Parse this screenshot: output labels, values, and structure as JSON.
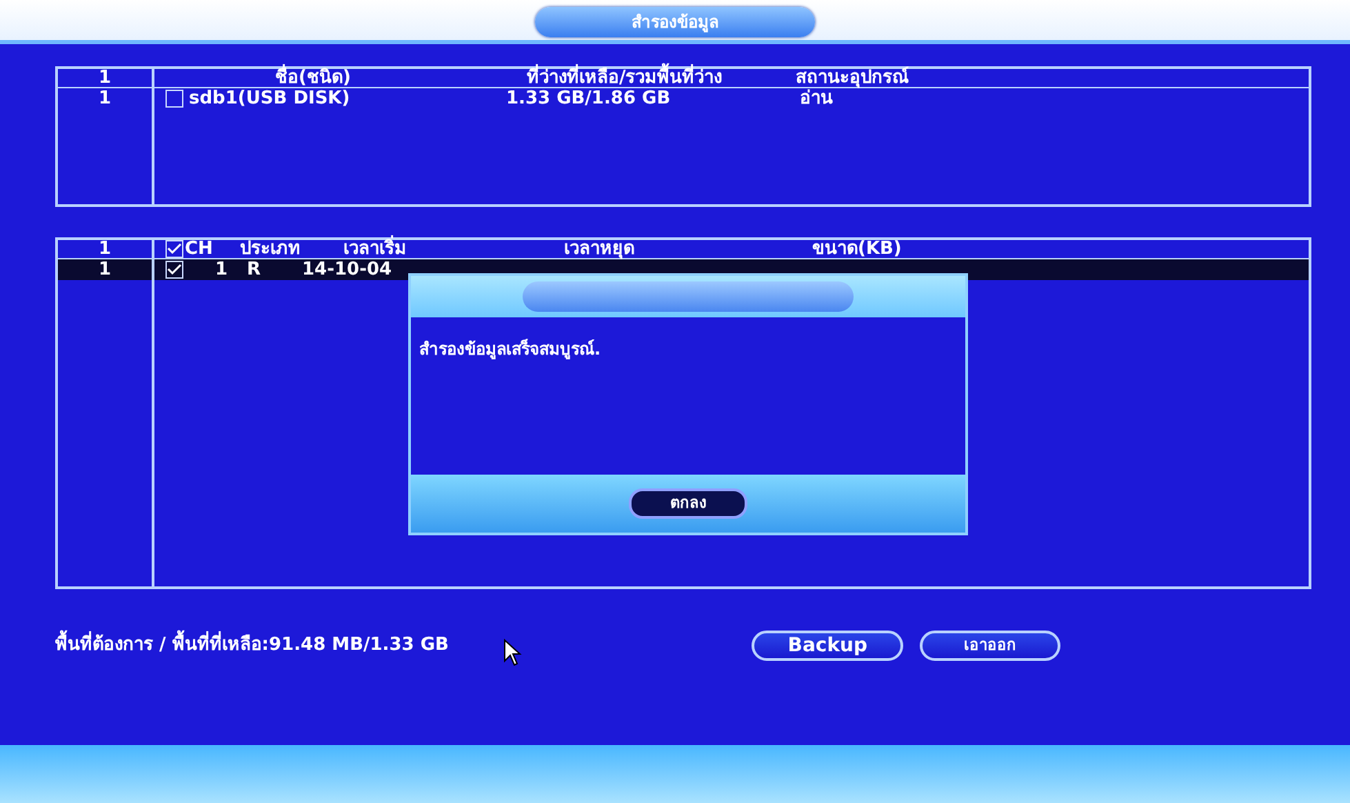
{
  "window": {
    "title": "สำรองข้อมูล"
  },
  "devices": {
    "columns": [
      "1",
      "ชื่อ(ชนิด)",
      "ที่ว่างที่เหลือ/รวมพื้นที่ว่าง",
      "สถานะอุปกรณ์"
    ],
    "rows": [
      {
        "index": "1",
        "checked": false,
        "name": "sdb1(USB DISK)",
        "space": "1.33 GB/1.86 GB",
        "status": "อ่าน"
      }
    ]
  },
  "files": {
    "columns": [
      "1",
      "CH",
      "ประเภท",
      "เวลาเริ่ม",
      "เวลาหยุด",
      "ขนาด(KB)"
    ],
    "all_checked": true,
    "rows": [
      {
        "index": "1",
        "checked": true,
        "selected": true,
        "channel": "1",
        "type": "R",
        "start": "14-10-04"
      }
    ]
  },
  "summary": "พื้นที่ต้องการ / พื้นที่ที่เหลือ:91.48 MB/1.33 GB",
  "buttons": [
    "Backup",
    "เอาออก"
  ],
  "dialog": {
    "message": "สำรองข้อมูลเสร็จสมบูรณ์.",
    "button": "ตกลง"
  }
}
